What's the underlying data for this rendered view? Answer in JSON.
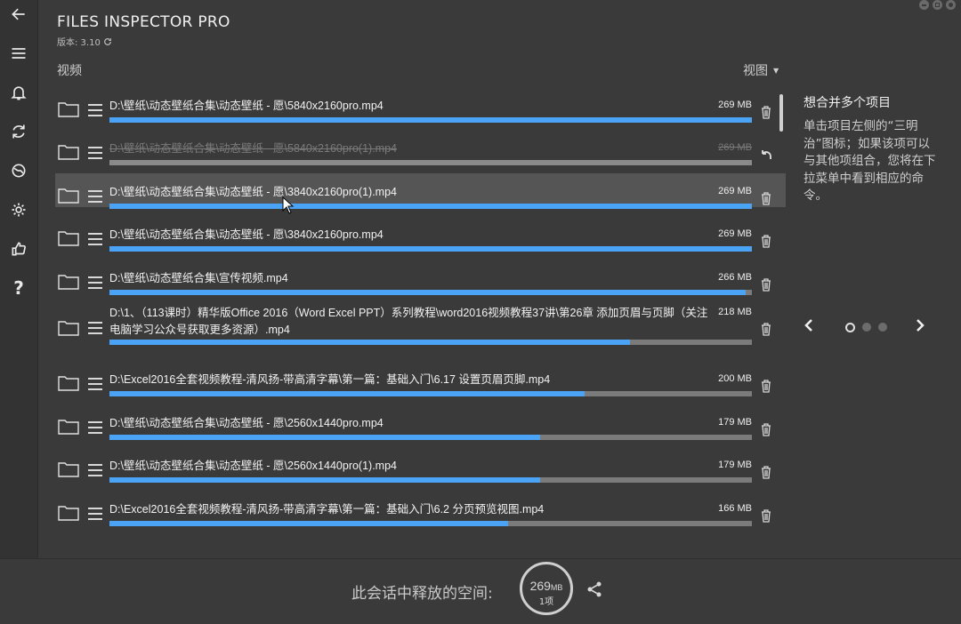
{
  "window": {
    "minimize": "minimize",
    "maximize": "maximize",
    "close": "close"
  },
  "header": {
    "app_title": "FILES INSPECTOR PRO",
    "version": "版本: 3.10"
  },
  "section": {
    "label": "视频",
    "view_menu": "视图"
  },
  "files": [
    {
      "path": "D:\\壁纸\\动态壁纸合集\\动态壁纸 - 愿\\5840x2160pro.mp4",
      "size": "269 MB",
      "fill": 1.0,
      "state": "normal"
    },
    {
      "path": "D:\\壁纸\\动态壁纸合集\\动态壁纸 - 愿\\5840x2160pro(1).mp4",
      "size": "269 MB",
      "fill": 1.0,
      "state": "removed"
    },
    {
      "path": "D:\\壁纸\\动态壁纸合集\\动态壁纸 - 愿\\3840x2160pro(1).mp4",
      "size": "269 MB",
      "fill": 1.0,
      "state": "hover"
    },
    {
      "path": "D:\\壁纸\\动态壁纸合集\\动态壁纸 - 愿\\3840x2160pro.mp4",
      "size": "269 MB",
      "fill": 1.0,
      "state": "normal"
    },
    {
      "path": "D:\\壁纸\\动态壁纸合集\\宣传视频.mp4",
      "size": "266 MB",
      "fill": 0.99,
      "state": "normal"
    },
    {
      "path": "D:\\1、（113课时）精华版Office 2016（Word Excel PPT）系列教程\\word2016视频教程37讲\\第26章 添加页眉与页脚（关注电脑学习公众号获取更多资源）.mp4",
      "size": "218 MB",
      "fill": 0.81,
      "state": "normal"
    },
    {
      "path": "D:\\Excel2016全套视频教程-清风扬-带高清字幕\\第一篇：基础入门\\6.17 设置页眉页脚.mp4",
      "size": "200 MB",
      "fill": 0.74,
      "state": "normal"
    },
    {
      "path": "D:\\壁纸\\动态壁纸合集\\动态壁纸 - 愿\\2560x1440pro.mp4",
      "size": "179 MB",
      "fill": 0.67,
      "state": "normal"
    },
    {
      "path": "D:\\壁纸\\动态壁纸合集\\动态壁纸 - 愿\\2560x1440pro(1).mp4",
      "size": "179 MB",
      "fill": 0.67,
      "state": "normal"
    },
    {
      "path": "D:\\Excel2016全套视频教程-清风扬-带高清字幕\\第一篇：基础入门\\6.2 分页预览视图.mp4",
      "size": "166 MB",
      "fill": 0.62,
      "state": "normal"
    }
  ],
  "tip": {
    "title": "想合并多个项目",
    "body": "单击项目左侧的“三明治”图标；如果该项可以与其他项组合，您将在下拉菜单中看到相应的命令。"
  },
  "pager": {
    "pages": 3,
    "current": 0
  },
  "footer": {
    "label": "此会话中释放的空间:",
    "freed_value": "269",
    "freed_unit": "MB",
    "item_count": "1项"
  },
  "colors": {
    "background": "#3a3a3a",
    "accent": "#4aa3f5",
    "bar_track": "#7b7b7b"
  }
}
